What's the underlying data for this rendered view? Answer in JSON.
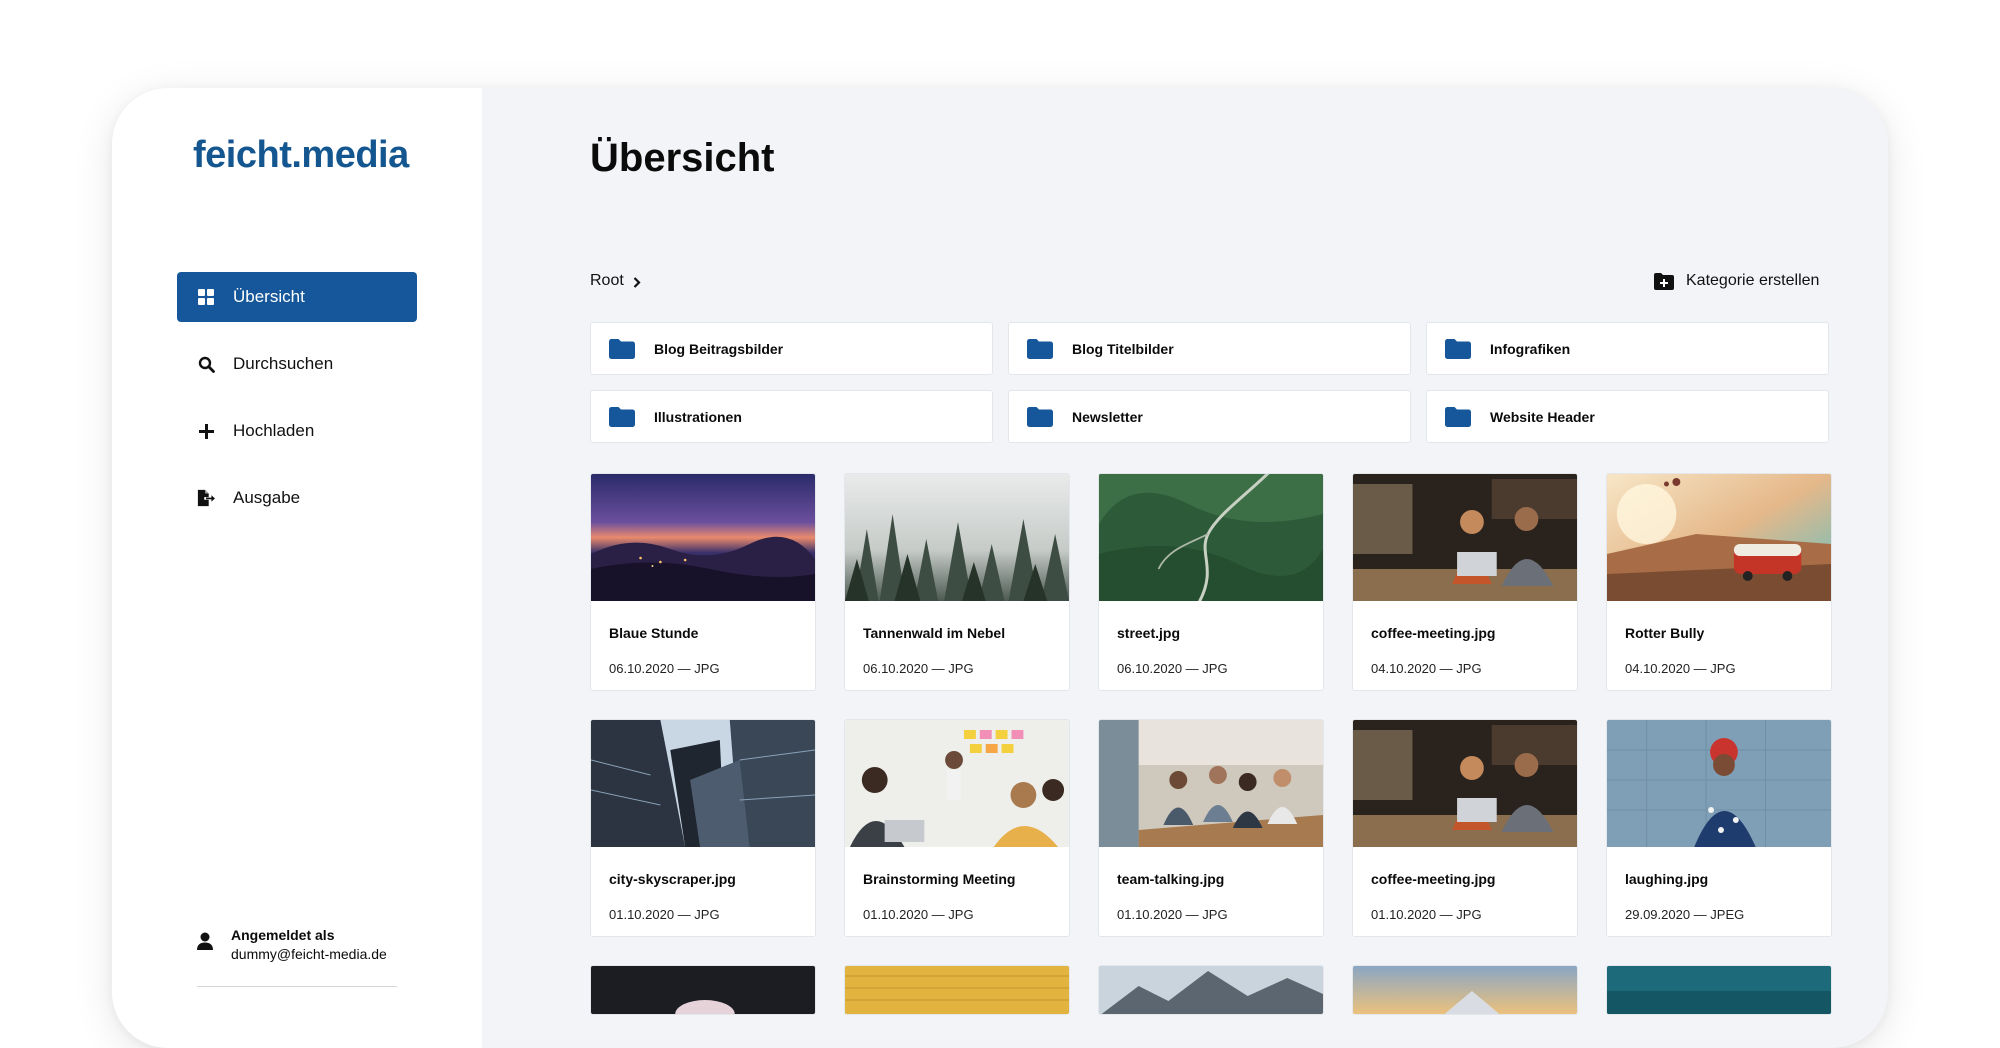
{
  "brand": {
    "logo": "feicht.media"
  },
  "sidebar": {
    "nav": [
      {
        "label": "Übersicht",
        "icon": "dashboard-icon",
        "active": true
      },
      {
        "label": "Durchsuchen",
        "icon": "search-icon",
        "active": false
      },
      {
        "label": "Hochladen",
        "icon": "plus-icon",
        "active": false
      },
      {
        "label": "Ausgabe",
        "icon": "file-export-icon",
        "active": false
      }
    ],
    "user": {
      "label": "Angemeldet als",
      "email": "dummy@feicht-media.de",
      "icon": "user-icon"
    }
  },
  "main": {
    "title": "Übersicht",
    "breadcrumb": {
      "root": "Root",
      "icon": "chevron-right-icon"
    },
    "create_category": {
      "label": "Kategorie erstellen",
      "icon": "folder-plus-icon"
    },
    "folders": [
      {
        "name": "Blog Beitragsbilder",
        "icon": "folder-icon"
      },
      {
        "name": "Blog Titelbilder",
        "icon": "folder-icon"
      },
      {
        "name": "Infografiken",
        "icon": "folder-icon"
      },
      {
        "name": "Illustrationen",
        "icon": "folder-icon"
      },
      {
        "name": "Newsletter",
        "icon": "folder-icon"
      },
      {
        "name": "Website Header",
        "icon": "folder-icon"
      }
    ],
    "images": [
      {
        "name": "Blaue Stunde",
        "meta": "06.10.2020 — JPG"
      },
      {
        "name": "Tannenwald im Nebel",
        "meta": "06.10.2020 — JPG"
      },
      {
        "name": "street.jpg",
        "meta": "06.10.2020 — JPG"
      },
      {
        "name": "coffee-meeting.jpg",
        "meta": "04.10.2020 — JPG"
      },
      {
        "name": "Rotter Bully",
        "meta": "04.10.2020 — JPG"
      },
      {
        "name": "city-skyscraper.jpg",
        "meta": "01.10.2020 — JPG"
      },
      {
        "name": "Brainstorming Meeting",
        "meta": "01.10.2020 — JPG"
      },
      {
        "name": "team-talking.jpg",
        "meta": "01.10.2020 — JPG"
      },
      {
        "name": "coffee-meeting.jpg",
        "meta": "01.10.2020 — JPG"
      },
      {
        "name": "laughing.jpg",
        "meta": "29.09.2020 — JPEG"
      }
    ]
  },
  "colors": {
    "accent": "#15579a",
    "logo": "#14568f",
    "background": "#f2f4f7"
  }
}
